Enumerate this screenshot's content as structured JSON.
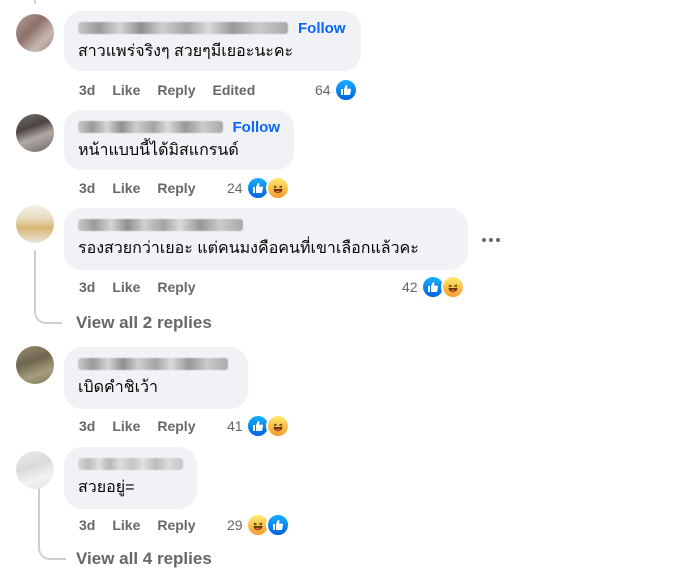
{
  "comments": [
    {
      "follow": "Follow",
      "text": "สาวแพร่จริงๆ สวยๆมีเยอะนะคะ",
      "time": "3d",
      "like": "Like",
      "reply": "Reply",
      "edited": "Edited",
      "reaction_count": "64",
      "reactions": [
        "like-icon"
      ]
    },
    {
      "follow": "Follow",
      "text": "หน้าแบบนี้ได้มิสแกรนด์",
      "time": "3d",
      "like": "Like",
      "reply": "Reply",
      "reaction_count": "24",
      "reactions": [
        "like-icon",
        "haha-icon"
      ]
    },
    {
      "text": "รองสวยกว่าเยอะ แต่คนมงคือคนที่เขาเลือกแล้วคะ",
      "time": "3d",
      "like": "Like",
      "reply": "Reply",
      "reaction_count": "42",
      "reactions": [
        "like-icon",
        "haha-icon"
      ],
      "view_replies": "View all 2 replies"
    },
    {
      "text": "เบิดคำชิเว้า",
      "time": "3d",
      "like": "Like",
      "reply": "Reply",
      "reaction_count": "41",
      "reactions": [
        "like-icon",
        "haha-icon"
      ]
    },
    {
      "text": "สวยอยู่=",
      "time": "3d",
      "like": "Like",
      "reply": "Reply",
      "reaction_count": "29",
      "reactions": [
        "haha-icon",
        "like-icon"
      ],
      "view_replies": "View all 4 replies"
    }
  ],
  "colors": {
    "accent": "#0866ff",
    "bubble": "#f0f2f5",
    "muted": "#65676b"
  }
}
